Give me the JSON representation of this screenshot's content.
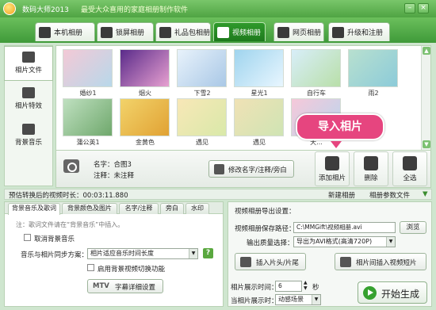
{
  "window": {
    "app_name": "数码大师2013",
    "tagline": "最受大众喜用的家庭相册制作软件",
    "minimize_label": "–",
    "close_label": "×"
  },
  "tabs": [
    {
      "label": "本机相册",
      "active": false
    },
    {
      "label": "锁屏相册",
      "active": false
    },
    {
      "label": "礼品包相册",
      "active": false
    },
    {
      "label": "视频相册",
      "active": true
    },
    {
      "label": "网页相册",
      "active": false
    },
    {
      "label": "升级和注册",
      "active": false
    }
  ],
  "sidebar": {
    "items": [
      {
        "label": "相片文件",
        "icon": "camera-icon"
      },
      {
        "label": "相片特效",
        "icon": "effects-icon"
      },
      {
        "label": "背景音乐",
        "icon": "music-note-icon"
      }
    ]
  },
  "gallery": {
    "row1": [
      {
        "caption": "婚纱1",
        "colors": [
          "#f3c9d6",
          "#b8d8ea"
        ]
      },
      {
        "caption": "烟火",
        "colors": [
          "#5a2b8a",
          "#e7a0d0"
        ]
      },
      {
        "caption": "下雪2",
        "colors": [
          "#e8f2fb",
          "#a9c8e6"
        ]
      },
      {
        "caption": "星光1",
        "colors": [
          "#9fd4ee",
          "#e8f6ff"
        ]
      },
      {
        "caption": "自行车",
        "colors": [
          "#d8eef9",
          "#b9dfa9"
        ]
      },
      {
        "caption": "雨2",
        "colors": [
          "#b8e0cf",
          "#8ccbd9"
        ]
      }
    ],
    "row2": [
      {
        "caption": "蒲公英1",
        "colors": [
          "#bfe0c0",
          "#6fa86c"
        ]
      },
      {
        "caption": "金黄色",
        "colors": [
          "#f2d36a",
          "#e1a234"
        ]
      },
      {
        "caption": "遇见",
        "colors": [
          "#f8e7b7",
          "#d9e9a9"
        ]
      },
      {
        "caption": "遇见",
        "colors": [
          "#f0e2b5",
          "#cfe4b4"
        ]
      },
      {
        "caption": "天...",
        "colors": [
          "#f6c8d9",
          "#b9d6ee"
        ]
      }
    ]
  },
  "callout": {
    "label": "导入相片"
  },
  "photo_info": {
    "name_line": "名字：合图3",
    "note_line": "注释：未注释",
    "edit_button": "修改名字/注释/旁白"
  },
  "toolbar": {
    "add_photo": "添加相片",
    "delete": "删除",
    "select_all": "全选"
  },
  "status": {
    "duration_text": "预估转换后的视频时长：00:03:11.880",
    "new_album": "新建相册",
    "album_params": "相册参数文件"
  },
  "settings": {
    "subtabs": [
      "背景音乐及歌词",
      "背景颜色及图片",
      "名字/注释",
      "旁白",
      "水印"
    ],
    "note": "注：歌词文件请在“背景音乐”中插入。",
    "cancel_music_label": "取消背景音乐",
    "sync_label": "音乐与相片同步方案：",
    "sync_value": "相片适应音乐时间长度",
    "switch_label": "启用背景视频切换功能",
    "mtv_label": "MTV",
    "subtitle_button": "字幕详细设置"
  },
  "export": {
    "heading": "视频相册导出设置：",
    "path_label": "视频相册保存路径：",
    "path_value": "C:\\MMGift\\视频相册.avi",
    "browse_label": "浏览",
    "quality_label": "输出质量选择：",
    "quality_value": "导出为AVI格式(高清720P)",
    "insert_head_label": "插入片头/片尾",
    "insert_clip_label": "相片间插入视频短片",
    "show_time_label": "相片展示时间：",
    "show_time_value": "6",
    "seconds_label": "秒",
    "transition_label": "当相片展示时：",
    "transition_value": "动感场景",
    "generate_label": "开始生成"
  }
}
